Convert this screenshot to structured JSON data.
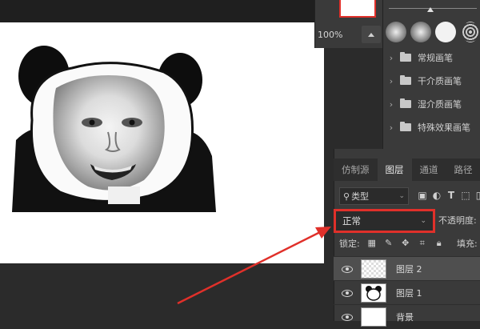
{
  "navigator": {
    "zoom": "100%"
  },
  "brushes": {
    "folders": [
      {
        "label": "常规画笔"
      },
      {
        "label": "干介质画笔"
      },
      {
        "label": "湿介质画笔"
      },
      {
        "label": "特殊效果画笔"
      }
    ]
  },
  "layers_panel": {
    "tabs": [
      {
        "label": "仿制源",
        "active": false
      },
      {
        "label": "图层",
        "active": true
      },
      {
        "label": "通道",
        "active": false
      },
      {
        "label": "路径",
        "active": false
      }
    ],
    "filter_label": "类型",
    "blend_mode": "正常",
    "opacity_label": "不透明度:",
    "lock_label": "锁定:",
    "fill_label": "填充:",
    "layers": [
      {
        "name": "图层 2",
        "selected": true
      },
      {
        "name": "图层 1",
        "selected": false
      },
      {
        "name": "背景",
        "selected": false
      }
    ]
  },
  "colors": {
    "highlight": "#e0302a",
    "panel": "#3a3a3a",
    "workspace": "#2b2b2b"
  }
}
